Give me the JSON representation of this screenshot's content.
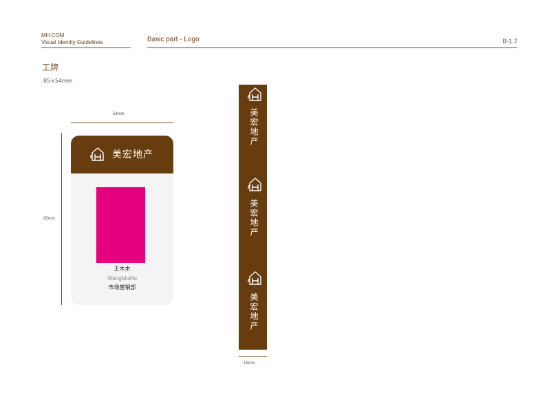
{
  "header": {
    "brand": "MH.COM",
    "subtitle": "Visual Identity Guidelines",
    "section": "Basic part - Logo",
    "page_code": "B-1.7"
  },
  "item": {
    "title": "工牌",
    "size": "85×54mm"
  },
  "dimensions": {
    "width": "54mm",
    "height": "85mm",
    "lanyard_width": "15mm"
  },
  "badge": {
    "logo_text": "美宏地产",
    "logo_icon": "house-logo-icon",
    "name": "王木木",
    "pinyin": "WangMuMu",
    "department": "市场营销部",
    "photo_color": "#e4007f",
    "header_color": "#673c0f"
  },
  "lanyard": {
    "logo_text": "美宏地产",
    "logo_icon": "house-logo-icon",
    "color": "#673c0f"
  }
}
